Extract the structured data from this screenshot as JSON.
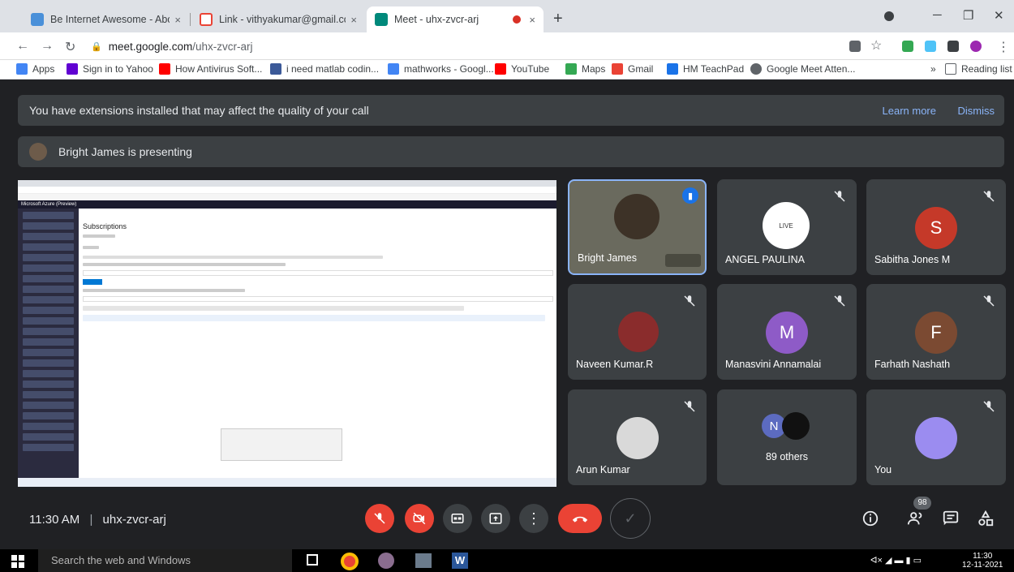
{
  "browser": {
    "tabs": [
      {
        "title": "Be Internet Awesome - About",
        "close": "×"
      },
      {
        "title": "Link - vithyakumar@gmail.com",
        "close": "×"
      },
      {
        "title": "Meet - uhx-zvcr-arj",
        "close": "×"
      }
    ],
    "new_tab": "+",
    "url_host": "meet.google.com",
    "url_path": "/uhx-zvcr-arj"
  },
  "bookmarks": [
    {
      "label": "Apps",
      "color": "#4285f4"
    },
    {
      "label": "Sign in to Yahoo",
      "color": "#6001d2"
    },
    {
      "label": "How Antivirus Soft...",
      "color": "#ff0000"
    },
    {
      "label": "i need matlab codin...",
      "color": "#3b5998"
    },
    {
      "label": "mathworks - Googl...",
      "color": "#4285f4"
    },
    {
      "label": "YouTube",
      "color": "#ff0000"
    },
    {
      "label": "Maps",
      "color": "#34a853"
    },
    {
      "label": "Gmail",
      "color": "#ea4335"
    },
    {
      "label": "HM TeachPad",
      "color": "#1a73e8"
    },
    {
      "label": "Google Meet Atten...",
      "color": "#5f6368"
    }
  ],
  "bookmarks_more": "»",
  "reading_list": "Reading list",
  "meet": {
    "banner": {
      "text": "You have extensions installed that may affect the quality of your call",
      "learn_more": "Learn more",
      "dismiss": "Dismiss"
    },
    "presenting": "Bright James is presenting",
    "shared_screen": {
      "portal": "Microsoft Azure (Preview)",
      "heading": "Subscriptions"
    },
    "participants": [
      {
        "name": "Bright James",
        "initial": "",
        "color": "",
        "speaking": true
      },
      {
        "name": "ANGEL PAULINA",
        "initial": "",
        "color": "",
        "logo": "LIVE"
      },
      {
        "name": "Sabitha Jones M",
        "initial": "S",
        "color": "#c53929"
      },
      {
        "name": "Naveen Kumar.R",
        "initial": "",
        "color": ""
      },
      {
        "name": "Manasvini Annamalai",
        "initial": "M",
        "color": "#8e5bc7"
      },
      {
        "name": "Farhath Nashath",
        "initial": "F",
        "color": "#7b4a32"
      },
      {
        "name": "Arun Kumar",
        "initial": "",
        "color": ""
      },
      {
        "name": "89 others",
        "initial": "N",
        "color": "#5c6bc0"
      },
      {
        "name": "You",
        "initial": "",
        "color": ""
      }
    ],
    "time": "11:30 AM",
    "meeting_code": "uhx-zvcr-arj",
    "participant_count": "98"
  },
  "taskbar": {
    "search": "Search the web and Windows",
    "clock_time": "11:30",
    "clock_date": "12-11-2021"
  }
}
